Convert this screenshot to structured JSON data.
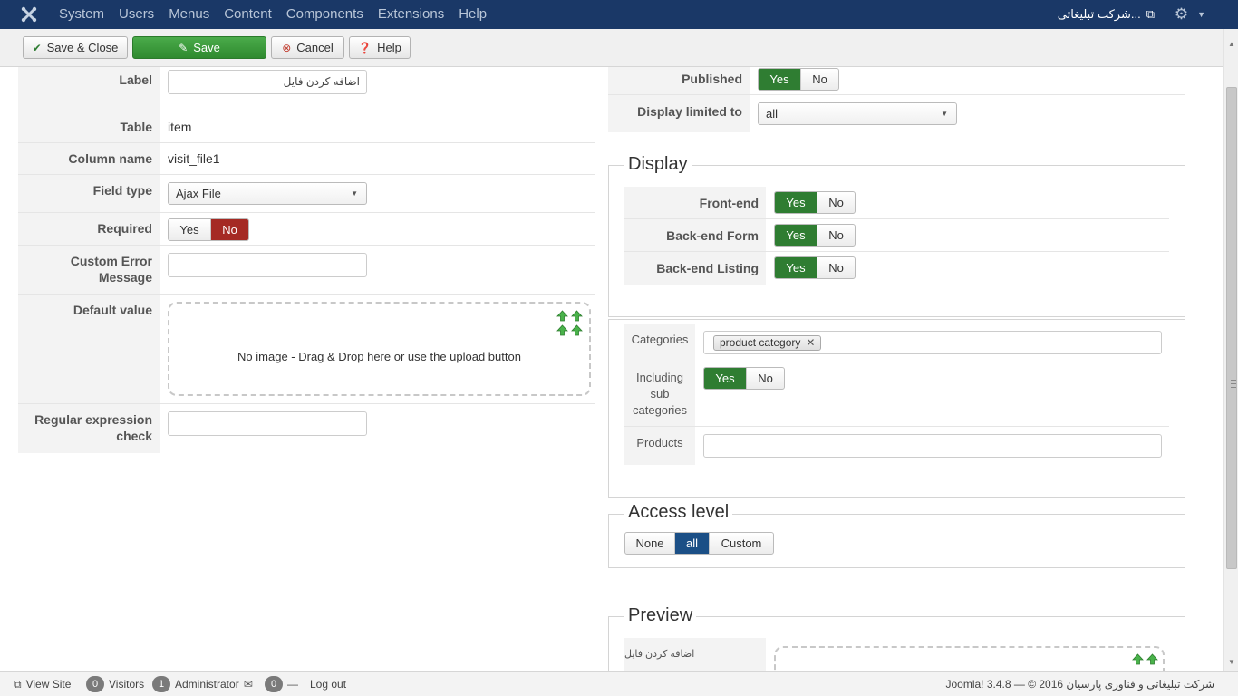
{
  "topbar": {
    "menu": [
      "System",
      "Users",
      "Menus",
      "Content",
      "Components",
      "Extensions",
      "Help"
    ],
    "site_name": "شرکت تبلیغاتی...",
    "icons": {
      "logo": "joomla-icon",
      "external": "external-link-icon",
      "settings": "gear-icon"
    }
  },
  "toolbar": {
    "save_close": "Save & Close",
    "save": "Save",
    "cancel": "Cancel",
    "help": "Help"
  },
  "form": {
    "label": {
      "label": "Label",
      "value": "اضافه کردن فایل"
    },
    "table": {
      "label": "Table",
      "value": "item"
    },
    "column_name": {
      "label": "Column name",
      "value": "visit_file1"
    },
    "field_type": {
      "label": "Field type",
      "value": "Ajax File"
    },
    "required": {
      "label": "Required",
      "yes": "Yes",
      "no": "No",
      "selected": "No"
    },
    "custom_error": {
      "label_line1": "Custom Error",
      "label_line2": "Message",
      "value": ""
    },
    "default_value": {
      "label": "Default value",
      "dropzone_text": "No image - Drag & Drop here or use the upload button"
    },
    "regex": {
      "label_line1": "Regular expression",
      "label_line2": "check",
      "value": ""
    }
  },
  "right": {
    "published": {
      "label": "Published",
      "yes": "Yes",
      "no": "No",
      "selected": "Yes"
    },
    "display_limited": {
      "label": "Display limited to",
      "value": "all"
    },
    "display": {
      "legend": "Display",
      "frontend": {
        "label": "Front-end",
        "yes": "Yes",
        "no": "No",
        "selected": "Yes"
      },
      "backend_form": {
        "label": "Back-end Form",
        "yes": "Yes",
        "no": "No",
        "selected": "Yes"
      },
      "backend_listing": {
        "label": "Back-end Listing",
        "yes": "Yes",
        "no": "No",
        "selected": "Yes"
      }
    },
    "categories": {
      "label": "Categories",
      "tag": "product category",
      "including_label_1": "Including",
      "including_label_2": "sub",
      "including_label_3": "categories",
      "yes": "Yes",
      "no": "No",
      "selected": "Yes",
      "products_label": "Products",
      "products_value": ""
    },
    "access": {
      "legend": "Access level",
      "options": [
        "None",
        "all",
        "Custom"
      ],
      "selected": "all"
    },
    "preview": {
      "legend": "Preview",
      "field_label": "اضافه کردن فایل"
    }
  },
  "statusbar": {
    "view_site": "View Site",
    "visitors_count": "0",
    "visitors": "Visitors",
    "admin_count": "1",
    "administrator": "Administrator",
    "messages_count": "0",
    "logout": "Log out",
    "copyright": "Joomla! 3.4.8 — © 2016 شرکت تبلیغاتی و فناوری پارسیان"
  },
  "colors": {
    "navbar": "#1a3867",
    "green": "#2f7d32",
    "red": "#a52a24",
    "blue": "#1b4f86"
  }
}
